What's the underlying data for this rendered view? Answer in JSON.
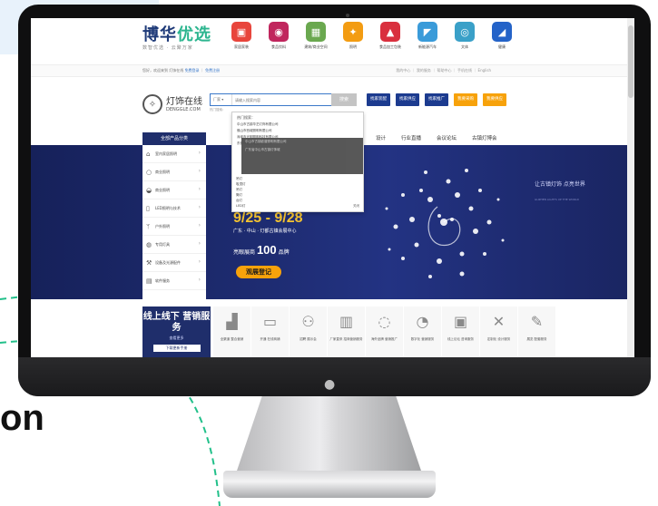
{
  "background": {
    "partial_text": "on"
  },
  "site": {
    "brand_main": "博华",
    "brand_highlight": "优选",
    "brand_sub": "数智优选 · 云聚万家",
    "top_nav": [
      {
        "label": "家居家装",
        "color": "#e8453c",
        "icon": "sofa-icon",
        "glyph": "▣"
      },
      {
        "label": "食品饮料",
        "color": "#c0265d",
        "icon": "drink-icon",
        "glyph": "◉"
      },
      {
        "label": "建筑/商业空间",
        "color": "#6aa84f",
        "icon": "building-icon",
        "glyph": "▦"
      },
      {
        "label": "照明",
        "color": "#f39c12",
        "icon": "lamp-icon",
        "glyph": "✦"
      },
      {
        "label": "食品加工包装",
        "color": "#d9303e",
        "icon": "package-icon",
        "glyph": "▲"
      },
      {
        "label": "新能源汽车",
        "color": "#3a9bd9",
        "icon": "car-icon",
        "glyph": "◤"
      },
      {
        "label": "文体",
        "color": "#3aa0c8",
        "icon": "target-icon",
        "glyph": "◎"
      },
      {
        "label": "健康",
        "color": "#2463c8",
        "icon": "health-icon",
        "glyph": "◢"
      }
    ],
    "info_left_text": "您好，欢迎来到 灯饰在线",
    "info_left_login": "免费登录",
    "info_left_register": "免费注册",
    "info_right_links": "我的中心 ｜ 我的服务 ｜ 帮助中心 ｜ 手机在线 ｜ English",
    "logo_cn": "灯饰在线",
    "logo_en": "DENGGLE.COM",
    "search_scope": "厂家",
    "search_placeholder": "请输入搜索内容",
    "search_button": "搜索",
    "search_hot": "热门搜索：",
    "action_buttons": [
      "找家装配",
      "找家供应",
      "找家推广",
      "我要采购",
      "我要供应"
    ],
    "category_header": "全部产品分类",
    "categories": [
      {
        "label": "室内家居照明",
        "icon": "ceiling-lamp-icon",
        "glyph": "⌂"
      },
      {
        "label": "商业照明",
        "icon": "bulb-icon",
        "glyph": "○"
      },
      {
        "label": "商业照明",
        "icon": "spotlight-icon",
        "glyph": "◒"
      },
      {
        "label": "LED照明与技术",
        "icon": "led-icon",
        "glyph": "▯"
      },
      {
        "label": "户外照明",
        "icon": "outdoor-lamp-icon",
        "glyph": "ᛘ"
      },
      {
        "label": "专用灯具",
        "icon": "special-lamp-icon",
        "glyph": "◍"
      },
      {
        "label": "设备及光源配件",
        "icon": "tools-icon",
        "glyph": "⚒"
      },
      {
        "label": "软件服务",
        "icon": "software-icon",
        "glyph": "▤"
      }
    ],
    "nav_links": [
      "设计",
      "行业直播",
      "会议论坛",
      "古镇灯博会"
    ],
    "dropdown": {
      "title": "热门搜索：",
      "rows": [
        "中山市古镇华艺灯饰有限公司",
        "佛山市西城照明有限公司",
        "深圳市光明照明科技有限公司",
        "东莞市宏光电器有限公司"
      ],
      "dark_rows": [
        "中山市古镇欧普照明有限公司",
        "广东省中山市古镇灯饰城"
      ],
      "bottom_rows": [
        "吊灯",
        "吸顶灯",
        "吊灯",
        "筒灯",
        "台灯",
        "LED灯"
      ],
      "close": "关闭"
    },
    "banner": {
      "date": "9/25 - 9/28",
      "place": "广东 · 中山 · 灯都古镇会展中心",
      "stat_prefix": "亮眼展商",
      "stat_number": "100",
      "stat_suffix": "品牌",
      "register": "观展登记",
      "slogan": "让古镇灯饰 点亮世界",
      "slogan_en": "GUZHEN LIGHTS UP THE WORLD"
    },
    "services": {
      "promo_title": "线上线下 营销服务",
      "promo_sub": "查看更多",
      "promo_button": "下载更新手册",
      "items": [
        {
          "label": "全渠道 整合营销",
          "icon": "chart-icon",
          "glyph": "▟"
        },
        {
          "label": "开通 在线商铺",
          "icon": "store-icon",
          "glyph": "▭"
        },
        {
          "label": "招聘 展示会",
          "icon": "people-icon",
          "glyph": "⚇"
        },
        {
          "label": "厂家直采 招商营销服务",
          "icon": "building-icon",
          "glyph": "▥"
        },
        {
          "label": "海外品牌 营销推广",
          "icon": "planet-icon",
          "glyph": "◌"
        },
        {
          "label": "数字化 营销服务",
          "icon": "pie-icon",
          "glyph": "◔"
        },
        {
          "label": "线上论坛 咨询服务",
          "icon": "screen-icon",
          "glyph": "▣"
        },
        {
          "label": "定制化 设计服务",
          "icon": "design-icon",
          "glyph": "✕"
        },
        {
          "label": "展览 配套服务",
          "icon": "writing-icon",
          "glyph": "✎"
        }
      ]
    },
    "chat_label": "•••"
  }
}
